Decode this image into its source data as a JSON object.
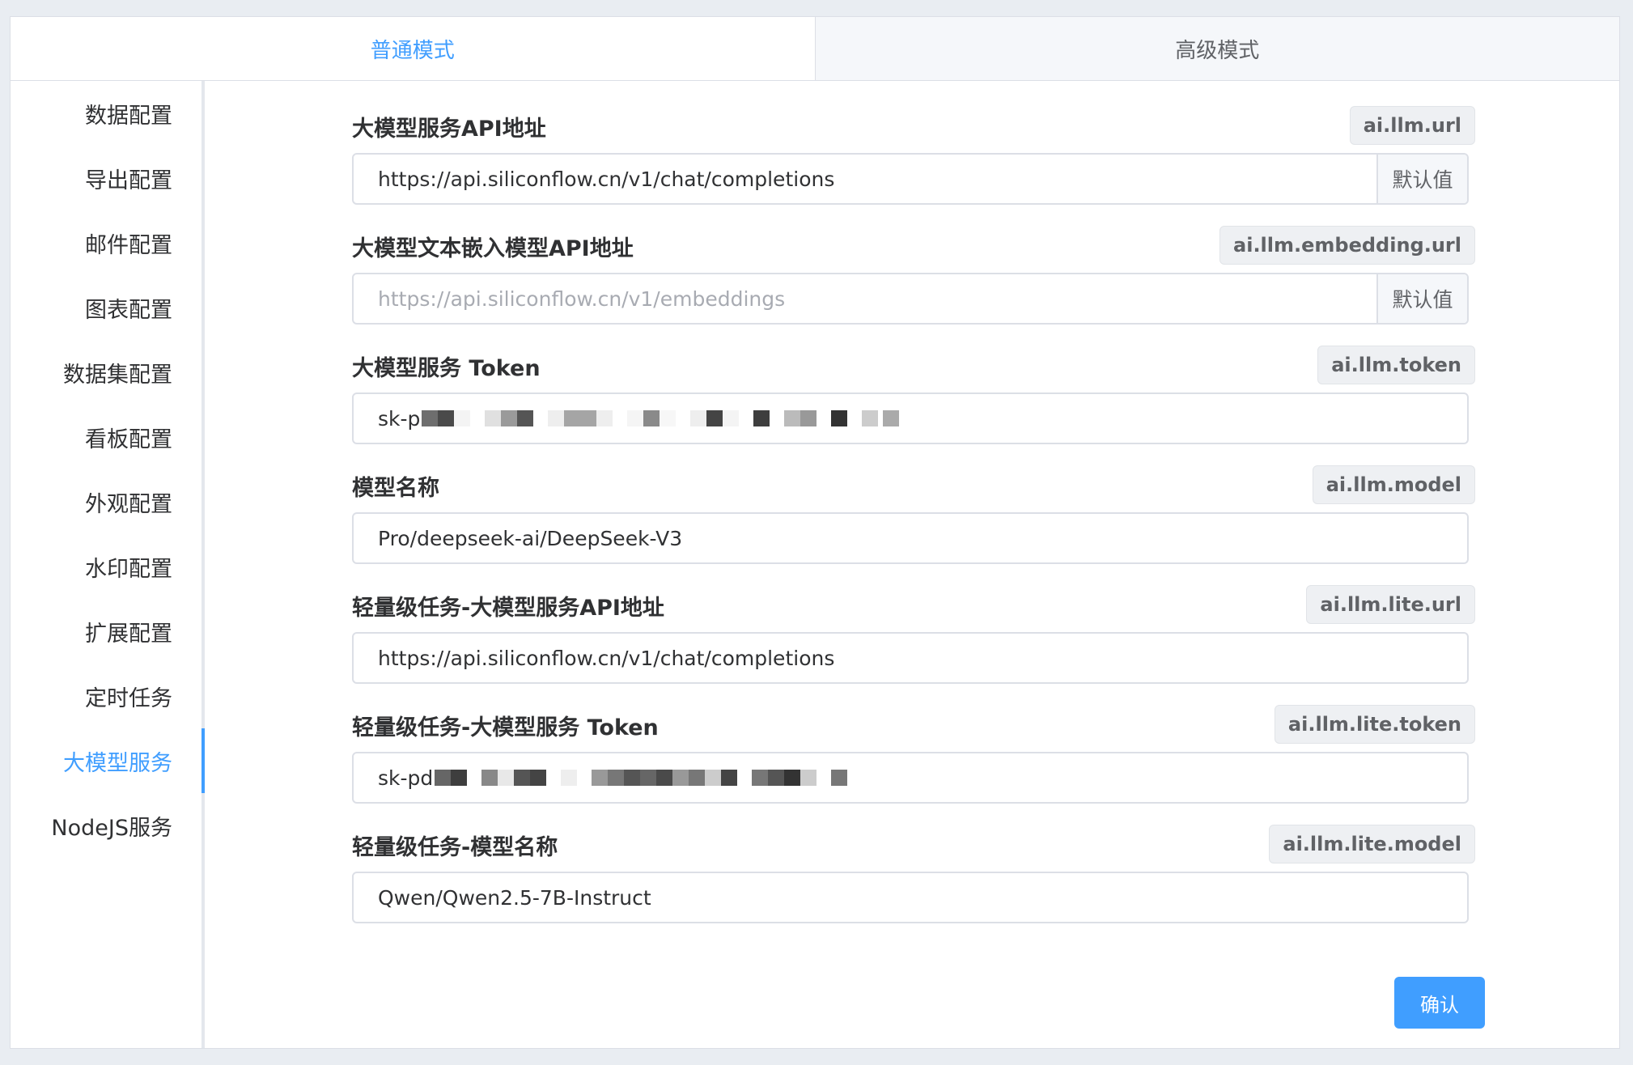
{
  "tabs": [
    {
      "label": "普通模式",
      "active": true
    },
    {
      "label": "高级模式",
      "active": false
    }
  ],
  "sidebar": {
    "items": [
      {
        "label": "数据配置"
      },
      {
        "label": "导出配置"
      },
      {
        "label": "邮件配置"
      },
      {
        "label": "图表配置"
      },
      {
        "label": "数据集配置"
      },
      {
        "label": "看板配置"
      },
      {
        "label": "外观配置"
      },
      {
        "label": "水印配置"
      },
      {
        "label": "扩展配置"
      },
      {
        "label": "定时任务"
      },
      {
        "label": "大模型服务",
        "active": true
      },
      {
        "label": "NodeJS服务"
      }
    ]
  },
  "form": {
    "fields": [
      {
        "label": "大模型服务API地址",
        "key": "ai.llm.url",
        "value": "https://api.siliconflow.cn/v1/chat/completions",
        "placeholder": "",
        "append": "默认值"
      },
      {
        "label": "大模型文本嵌入模型API地址",
        "key": "ai.llm.embedding.url",
        "value": "",
        "placeholder": "https://api.siliconflow.cn/v1/embeddings",
        "append": "默认值"
      },
      {
        "label": "大模型服务 Token",
        "key": "ai.llm.token",
        "value": "sk-p",
        "masked": true
      },
      {
        "label": "模型名称",
        "key": "ai.llm.model",
        "value": "Pro/deepseek-ai/DeepSeek-V3"
      },
      {
        "label": "轻量级任务-大模型服务API地址",
        "key": "ai.llm.lite.url",
        "value": "https://api.siliconflow.cn/v1/chat/completions"
      },
      {
        "label": "轻量级任务-大模型服务 Token",
        "key": "ai.llm.lite.token",
        "value": "sk-pd",
        "masked": true
      },
      {
        "label": "轻量级任务-模型名称",
        "key": "ai.llm.lite.model",
        "value": "Qwen/Qwen2.5-7B-Instruct"
      }
    ],
    "confirm_label": "确认"
  },
  "colors": {
    "accent": "#409eff",
    "border": "#dcdfe6",
    "text": "#303133",
    "muted": "#606266",
    "placeholder": "#a8abb2"
  }
}
